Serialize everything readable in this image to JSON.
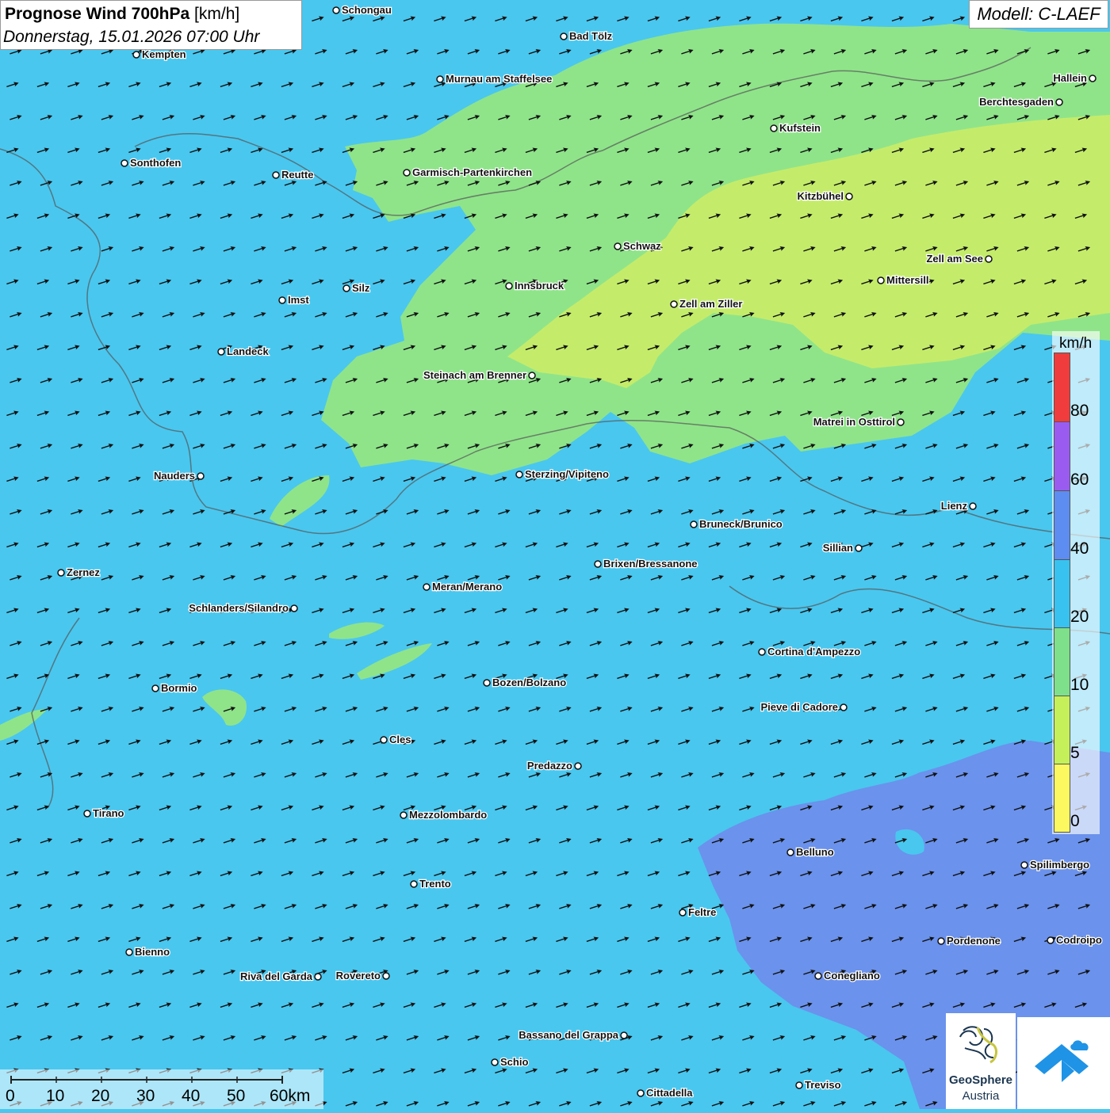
{
  "title": {
    "main": "Prognose Wind 700hPa",
    "unit": "[km/h]",
    "date": "Donnerstag, 15.01.2026 07:00 Uhr"
  },
  "model": "Modell: C-LAEF",
  "legend": {
    "unit": "km/h",
    "labels": [
      "80",
      "60",
      "40",
      "20",
      "10",
      "5",
      "0"
    ],
    "bands": [
      {
        "from": 80,
        "to": 100,
        "color": "#f03c3c"
      },
      {
        "from": 60,
        "to": 80,
        "color": "#9a5cf0"
      },
      {
        "from": 40,
        "to": 60,
        "color": "#5d8df0"
      },
      {
        "from": 20,
        "to": 40,
        "color": "#38c2ef"
      },
      {
        "from": 10,
        "to": 20,
        "color": "#7ee08a"
      },
      {
        "from": 5,
        "to": 10,
        "color": "#c5f05a"
      },
      {
        "from": 0,
        "to": 5,
        "color": "#fbf860"
      }
    ]
  },
  "scale": {
    "labels": [
      "0",
      "10",
      "20",
      "30",
      "40",
      "50",
      "60km"
    ]
  },
  "logos": {
    "geosphere_line1": "GeoSphere",
    "geosphere_line2": "Austria",
    "geosphere_icon": "geosphere-logo-icon",
    "partner_icon": "blue-arrow-cloud-logo-icon"
  },
  "cities": [
    {
      "name": "Schongau"
    },
    {
      "name": "Bad Tölz"
    },
    {
      "name": "Kempten"
    },
    {
      "name": "Murnau am Staffelsee"
    },
    {
      "name": "Hallein"
    },
    {
      "name": "Berchtesgaden"
    },
    {
      "name": "Kufstein"
    },
    {
      "name": "Sonthofen"
    },
    {
      "name": "Reutte"
    },
    {
      "name": "Garmisch-Partenkirchen"
    },
    {
      "name": "Kitzbühel"
    },
    {
      "name": "Schwaz"
    },
    {
      "name": "Zell am See"
    },
    {
      "name": "Mittersill"
    },
    {
      "name": "Innsbruck"
    },
    {
      "name": "Silz"
    },
    {
      "name": "Imst"
    },
    {
      "name": "Zell am Ziller"
    },
    {
      "name": "Landeck"
    },
    {
      "name": "Steinach am Brenner"
    },
    {
      "name": "Matrei in Osttirol"
    },
    {
      "name": "Nauders"
    },
    {
      "name": "Sterzing/Vipiteno"
    },
    {
      "name": "Lienz"
    },
    {
      "name": "Bruneck/Brunico"
    },
    {
      "name": "Sillian"
    },
    {
      "name": "Zernez"
    },
    {
      "name": "Brixen/Bressanone"
    },
    {
      "name": "Meran/Merano"
    },
    {
      "name": "Schlanders/Silandro"
    },
    {
      "name": "Cortina d'Ampezzo"
    },
    {
      "name": "Bozen/Bolzano"
    },
    {
      "name": "Bormio"
    },
    {
      "name": "Pieve di Cadore"
    },
    {
      "name": "Cles"
    },
    {
      "name": "Predazzo"
    },
    {
      "name": "Tirano"
    },
    {
      "name": "Mezzolombardo"
    },
    {
      "name": "Belluno"
    },
    {
      "name": "Spilimbergo"
    },
    {
      "name": "Trento"
    },
    {
      "name": "Feltre"
    },
    {
      "name": "Pordenone"
    },
    {
      "name": "Codroipo"
    },
    {
      "name": "Bienno"
    },
    {
      "name": "Riva del Garda"
    },
    {
      "name": "Rovereto"
    },
    {
      "name": "Conegliano"
    },
    {
      "name": "Bassano del Grappa"
    },
    {
      "name": "Schio"
    },
    {
      "name": "Treviso"
    },
    {
      "name": "Cittadella"
    }
  ],
  "colors": {
    "sea_blue_20_40": "#49c7ef",
    "green_10_20": "#8fe48a",
    "yellowgreen_5_10": "#c4ec6a",
    "violet_40_60": "#6b92ec",
    "arrow": "#111111",
    "border": "#555555"
  }
}
